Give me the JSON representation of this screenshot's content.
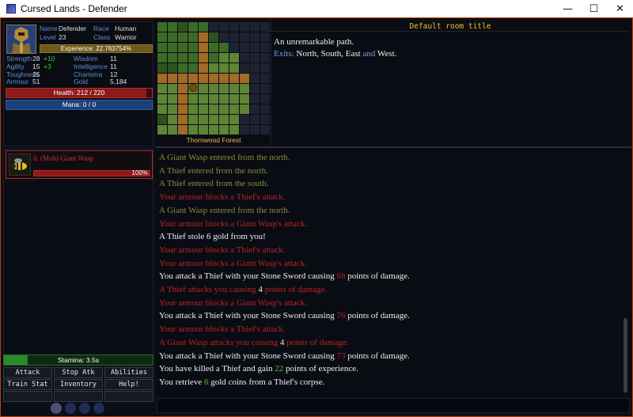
{
  "window": {
    "title": "Cursed Lands - Defender",
    "minimize": "—",
    "maximize": "☐",
    "close": "✕"
  },
  "character": {
    "name_label": "Name",
    "name": "Defender",
    "race_label": "Race",
    "race": "Human",
    "level_label": "Level",
    "level": "23",
    "class_label": "Class",
    "class": "Warrior",
    "experience": "Experience: 22.763754%",
    "stats": [
      {
        "label": "Strength",
        "value": "28",
        "bonus": "+10",
        "label2": "Wisdom",
        "value2": "11"
      },
      {
        "label": "Agility",
        "value": "15",
        "bonus": "+3",
        "label2": "Intelligence",
        "value2": "11"
      },
      {
        "label": "Toughness",
        "value": "25",
        "bonus": "",
        "label2": "Charisma",
        "value2": "12"
      },
      {
        "label": "Armour",
        "value": "51",
        "bonus": "",
        "label2": "Gold",
        "value2": "5,184"
      }
    ],
    "health": "Health: 212 / 220",
    "health_fraction": 0.964,
    "mana": "Mana: 0 / 0"
  },
  "mob": {
    "name": "0. (Mob) Giant Wasp",
    "health_pct": "100%",
    "icon": "wasp-icon"
  },
  "stamina": {
    "text": "Stamina: 3.5s",
    "fraction": 0.16
  },
  "buttons": [
    "Attack",
    "Stop Atk",
    "Abilities",
    "Train Stat",
    "Inventory",
    "Help!",
    "",
    "",
    ""
  ],
  "map": {
    "label": "Thornwood Forest"
  },
  "room": {
    "title": "Default room title",
    "desc": "An unremarkable path.",
    "exits_label": "Exits:",
    "exits_a": "North, South, East",
    "exits_and": "and",
    "exits_b": "West."
  },
  "log": [
    {
      "style": "olive",
      "parts": [
        {
          "t": "A Giant Wasp entered from the north."
        }
      ]
    },
    {
      "style": "olive",
      "parts": [
        {
          "t": "A Thief entered from the north."
        }
      ]
    },
    {
      "style": "olive",
      "parts": [
        {
          "t": "A Thief entered from the south."
        }
      ]
    },
    {
      "style": "red",
      "parts": [
        {
          "t": "Your armour blocks a Thief's attack."
        }
      ]
    },
    {
      "style": "olive",
      "parts": [
        {
          "t": "A Giant Wasp entered from the north."
        }
      ]
    },
    {
      "style": "red",
      "parts": [
        {
          "t": "Your armour blocks a Giant Wasp's attack."
        }
      ]
    },
    {
      "style": "white",
      "parts": [
        {
          "t": "A Thief stole 6 gold from you!"
        }
      ]
    },
    {
      "style": "red",
      "parts": [
        {
          "t": "Your armour blocks a Thief's attack."
        }
      ]
    },
    {
      "style": "red",
      "parts": [
        {
          "t": "Your armour blocks a Giant Wasp's attack."
        }
      ]
    },
    {
      "style": "white",
      "parts": [
        {
          "t": "You attack a Thief with your Stone Sword causing "
        },
        {
          "t": "68",
          "c": "num-red"
        },
        {
          "t": " points of damage."
        }
      ]
    },
    {
      "style": "red",
      "parts": [
        {
          "t": "A Thief attacks you causing "
        },
        {
          "t": "4",
          "c": "num-white"
        },
        {
          "t": " points of damage."
        }
      ]
    },
    {
      "style": "red",
      "parts": [
        {
          "t": "Your armour blocks a Giant Wasp's attack."
        }
      ]
    },
    {
      "style": "white",
      "parts": [
        {
          "t": "You attack a Thief with your Stone Sword causing "
        },
        {
          "t": "76",
          "c": "num-red"
        },
        {
          "t": " points of damage."
        }
      ]
    },
    {
      "style": "red",
      "parts": [
        {
          "t": "Your armour blocks a Thief's attack."
        }
      ]
    },
    {
      "style": "red",
      "parts": [
        {
          "t": "A Giant Wasp attacks you causing "
        },
        {
          "t": "4",
          "c": "num-white"
        },
        {
          "t": " points of damage."
        }
      ]
    },
    {
      "style": "white",
      "parts": [
        {
          "t": "You attack a Thief with your Stone Sword causing "
        },
        {
          "t": "73",
          "c": "num-red"
        },
        {
          "t": " points of damage."
        }
      ]
    },
    {
      "style": "white",
      "parts": [
        {
          "t": "You have killed a Thief and gain "
        },
        {
          "t": "22",
          "c": "num-green"
        },
        {
          "t": " points of experience."
        }
      ]
    },
    {
      "style": "white",
      "parts": [
        {
          "t": "You retrieve "
        },
        {
          "t": "6",
          "c": "num-green"
        },
        {
          "t": " gold coins from a Thief's corpse."
        }
      ]
    }
  ]
}
